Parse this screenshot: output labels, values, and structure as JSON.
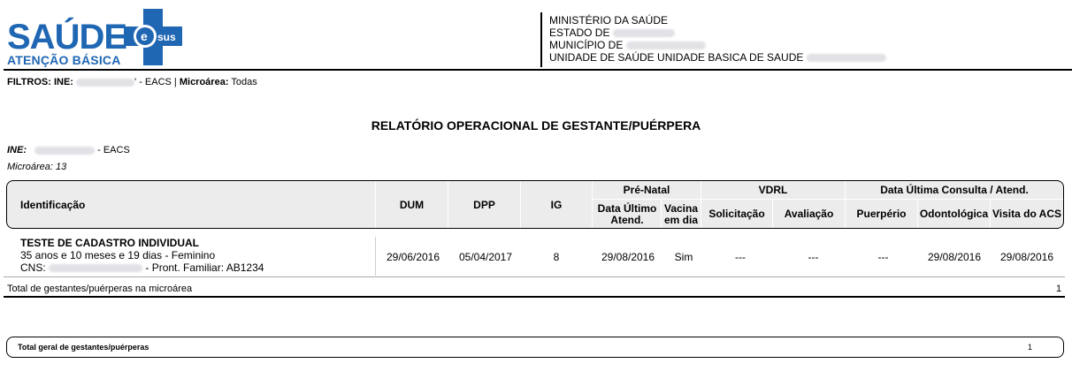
{
  "logo": {
    "main": "SAÚDE",
    "badge": "sus",
    "sub": "ATENÇÃO BÁSICA"
  },
  "header": {
    "line1": "MINISTÉRIO DA SAÚDE",
    "line2": "ESTADO DE",
    "line3": "MUNICÍPIO DE",
    "line4": "UNIDADE DE SAÚDE UNIDADE BASICA DE SAUDE"
  },
  "filters": {
    "label": "FILTROS: INE:",
    "ine_suffix": "' - EACS |",
    "micro_label": "Microárea:",
    "micro_value": "Todas"
  },
  "title": "RELATÓRIO OPERACIONAL DE GESTANTE/PUÉRPERA",
  "ine": {
    "label": "INE:",
    "suffix": "- EACS"
  },
  "microarea": "Microárea: 13",
  "table": {
    "headers": {
      "identificacao": "Identificação",
      "dum": "DUM",
      "dpp": "DPP",
      "ig": "IG",
      "prenatal": "Pré-Natal",
      "data_ultimo": "Data Último Atend.",
      "vacina": "Vacina em dia",
      "vdrl": "VDRL",
      "solicitacao": "Solicitação",
      "avaliacao": "Avaliação",
      "data_ultima": "Data Última Consulta / Atend.",
      "puerperio": "Puerpério",
      "odontologica": "Odontológica",
      "visita_acs": "Visita do ACS"
    },
    "row": {
      "name": "TESTE DE CADASTRO INDIVIDUAL",
      "age": "35 anos e 10 meses e 19 dias - Feminino",
      "cns_label": "CNS:",
      "pront": "- Pront. Familiar: AB1234",
      "dum": "29/06/2016",
      "dpp": "05/04/2017",
      "ig": "8",
      "data_ultimo": "29/08/2016",
      "vacina": "Sim",
      "solicitacao": "---",
      "avaliacao": "---",
      "puerperio": "---",
      "odontologica": "29/08/2016",
      "visita_acs": "29/08/2016"
    }
  },
  "total": {
    "label": "Total de gestantes/puérperas na microárea",
    "value": "1"
  },
  "grand_total": {
    "label": "Total geral de gestantes/puérperas",
    "value": "1"
  },
  "colors": {
    "logo_blue": "#1f66b3",
    "header_bg": "#ececec"
  }
}
